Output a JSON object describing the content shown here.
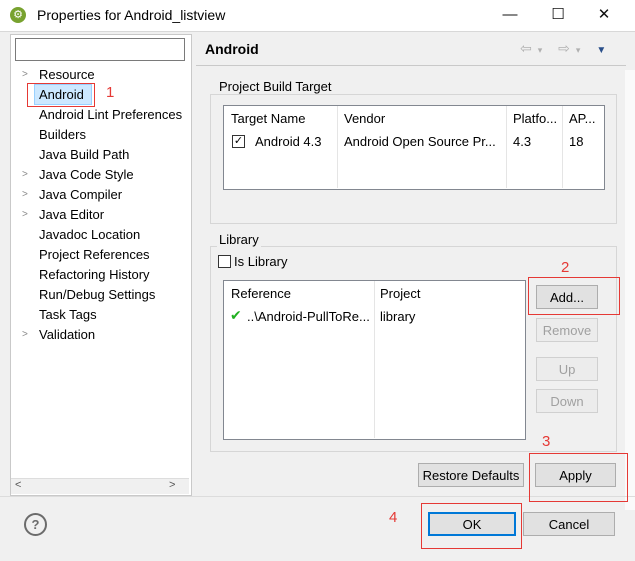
{
  "window": {
    "title": "Properties for Android_listview",
    "app_icon": "android-adt-icon",
    "controls": {
      "minimize": "—",
      "maximize": "☐",
      "close": "✕"
    }
  },
  "tree": {
    "filter_value": "",
    "items": [
      {
        "label": "Resource",
        "expandable": true
      },
      {
        "label": "Android",
        "expandable": false,
        "selected": true
      },
      {
        "label": "Android Lint Preferences",
        "expandable": false
      },
      {
        "label": "Builders",
        "expandable": false
      },
      {
        "label": "Java Build Path",
        "expandable": false
      },
      {
        "label": "Java Code Style",
        "expandable": true
      },
      {
        "label": "Java Compiler",
        "expandable": true
      },
      {
        "label": "Java Editor",
        "expandable": true
      },
      {
        "label": "Javadoc Location",
        "expandable": false
      },
      {
        "label": "Project References",
        "expandable": false
      },
      {
        "label": "Refactoring History",
        "expandable": false
      },
      {
        "label": "Run/Debug Settings",
        "expandable": false
      },
      {
        "label": "Task Tags",
        "expandable": false
      },
      {
        "label": "Validation",
        "expandable": true
      }
    ]
  },
  "page": {
    "title": "Android",
    "build_target": {
      "label": "Project Build Target",
      "columns": [
        "Target Name",
        "Vendor",
        "Platfo...",
        "AP..."
      ],
      "rows": [
        {
          "checked": true,
          "name": "Android 4.3",
          "vendor": "Android Open Source Pr...",
          "platform": "4.3",
          "api": "18"
        }
      ]
    },
    "library": {
      "label": "Library",
      "is_library_label": "Is Library",
      "is_library_checked": false,
      "columns": [
        "Reference",
        "Project"
      ],
      "rows": [
        {
          "status": "ok",
          "reference": "..\\Android-PullToRe...",
          "project": "library"
        }
      ],
      "buttons": {
        "add": "Add...",
        "remove": "Remove",
        "up": "Up",
        "down": "Down"
      }
    },
    "restore_defaults": "Restore Defaults",
    "apply": "Apply"
  },
  "footer": {
    "ok": "OK",
    "cancel": "Cancel",
    "help_icon": "?"
  },
  "annotations": {
    "n1": "1",
    "n2": "2",
    "n3": "3",
    "n4": "4",
    "color": "#e53935"
  }
}
